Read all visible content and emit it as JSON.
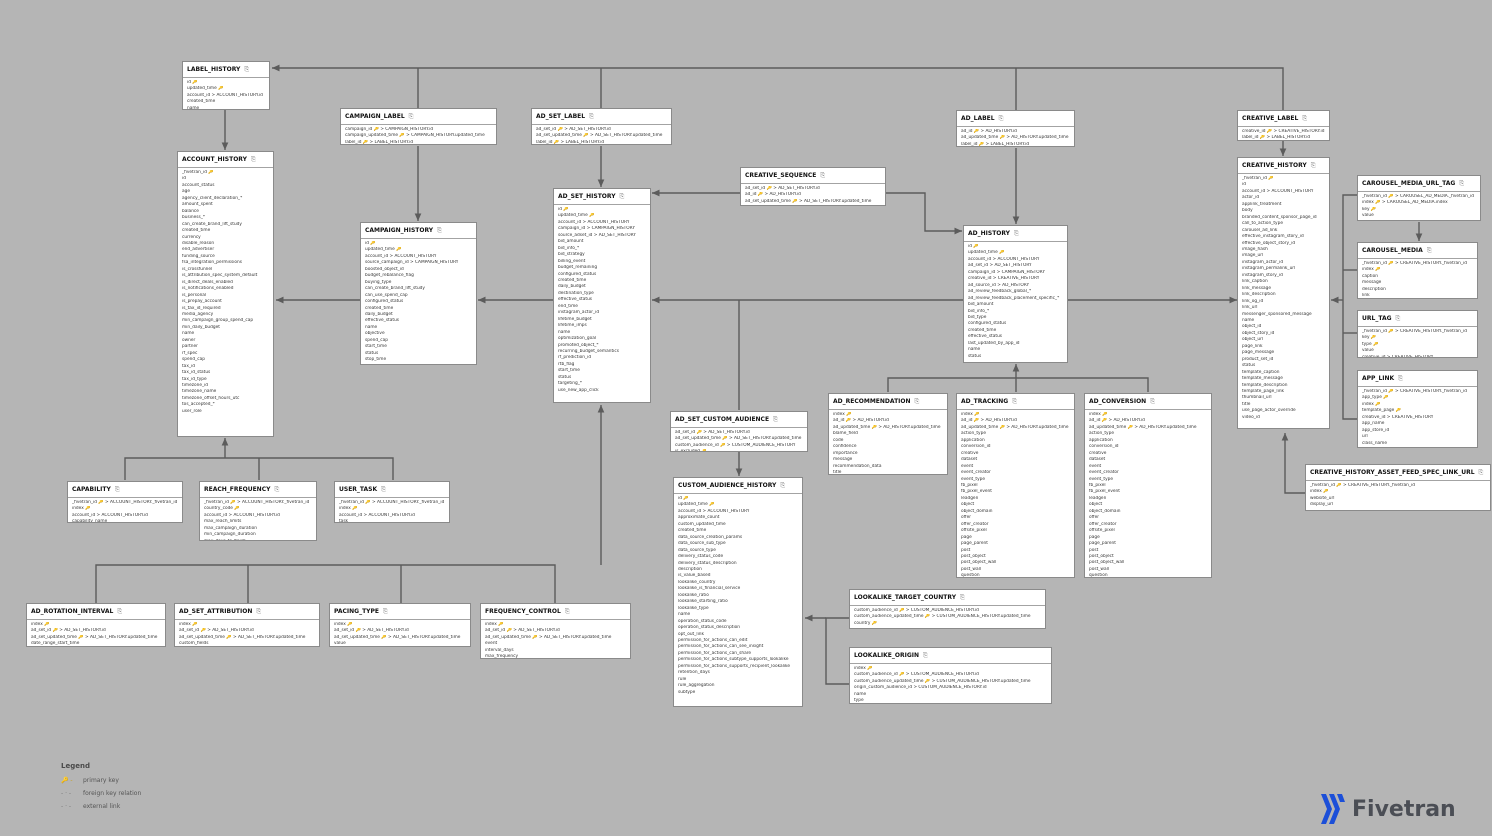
{
  "colors": {
    "background": "#b5b5b5",
    "line": "#5c5c5c",
    "primary_key": "#caa20a",
    "brand": "#1c4fd8"
  },
  "tables": [
    {
      "name": "LABEL_HISTORY",
      "fields": [
        "id 🔑",
        "updated_time 🔑",
        "account_id > ACCOUNT_HISTORY.id",
        "created_time",
        "name"
      ]
    },
    {
      "name": "CAMPAIGN_LABEL",
      "fields": [
        "campaign_id 🔑 > CAMPAIGN_HISTORY.id",
        "campaign_updated_time 🔑 > CAMPAIGN_HISTORY.updated_time",
        "label_id 🔑 > LABEL_HISTORY.id"
      ]
    },
    {
      "name": "AD_SET_LABEL",
      "fields": [
        "ad_set_id 🔑 > AD_SET_HISTORY.id",
        "ad_set_updated_time 🔑 > AD_SET_HISTORY.updated_time",
        "label_id 🔑 > LABEL_HISTORY.id"
      ]
    },
    {
      "name": "AD_LABEL",
      "fields": [
        "ad_id 🔑 > AD_HISTORY.id",
        "ad_updated_time 🔑 > AD_HISTORY.updated_time",
        "label_id 🔑 > LABEL_HISTORY.id"
      ]
    },
    {
      "name": "CREATIVE_LABEL",
      "fields": [
        "creative_id 🔑 > CREATIVE_HISTORY.id",
        "label_id 🔑 > LABEL_HISTORY.id"
      ]
    },
    {
      "name": "ACCOUNT_HISTORY",
      "fields": [
        "_fivetran_id 🔑",
        "id",
        "account_status",
        "age",
        "agency_client_declaration_*",
        "amount_spent",
        "balance",
        "business_*",
        "can_create_brand_lift_study",
        "created_time",
        "currency",
        "disable_reason",
        "end_advertiser",
        "funding_source",
        "fsa_integration_permissions",
        "is_crossfunnel",
        "is_attribution_spec_system_default",
        "is_direct_deals_enabled",
        "is_notifications_enabled",
        "is_personal",
        "is_prepay_account",
        "is_tax_id_required",
        "media_agency",
        "min_campaign_group_spend_cap",
        "min_daily_budget",
        "name",
        "owner",
        "partner",
        "rf_spec",
        "spend_cap",
        "tax_id",
        "tax_id_status",
        "tax_id_type",
        "timezone_id",
        "timezone_name",
        "timezone_offset_hours_utc",
        "tos_accepted_*",
        "user_role"
      ]
    },
    {
      "name": "CAMPAIGN_HISTORY",
      "fields": [
        "id 🔑",
        "updated_time 🔑",
        "account_id > ACCOUNT_HISTORY",
        "source_campaign_id > CAMPAIGN_HISTORY",
        "boosted_object_id",
        "budget_rebalance_flag",
        "buying_type",
        "can_create_brand_lift_study",
        "can_use_spend_cap",
        "configured_status",
        "created_time",
        "daily_budget",
        "effective_status",
        "name",
        "objective",
        "spend_cap",
        "start_time",
        "status",
        "stop_time"
      ]
    },
    {
      "name": "AD_SET_HISTORY",
      "fields": [
        "id 🔑",
        "updated_time 🔑",
        "account_id > ACCOUNT_HISTORY",
        "campaign_id > CAMPAIGN_HISTORY",
        "source_adset_id > AD_SET_HISTORY",
        "bid_amount",
        "bid_info_*",
        "bid_strategy",
        "billing_event",
        "budget_remaining",
        "configured_status",
        "created_time",
        "daily_budget",
        "destination_type",
        "effective_status",
        "end_time",
        "instagram_actor_id",
        "lifetime_budget",
        "lifetime_imps",
        "name",
        "optimization_goal",
        "promoted_object_*",
        "recurring_budget_semantics",
        "rf_prediction_id",
        "rtb_flag",
        "start_time",
        "status",
        "targeting_*",
        "use_new_app_click"
      ]
    },
    {
      "name": "CREATIVE_SEQUENCE",
      "fields": [
        "ad_set_id 🔑 > AD_SET_HISTORY.id",
        "ad_id 🔑 > AD_HISTORY.id",
        "ad_set_updated_time 🔑 > AD_SET_HISTORY.updated_time"
      ]
    },
    {
      "name": "AD_HISTORY",
      "fields": [
        "id 🔑",
        "updated_time 🔑",
        "account_id > ACCOUNT_HISTORY",
        "ad_set_id > AD_SET_HISTORY",
        "campaign_id > CAMPAIGN_HISTORY",
        "creative_id > CREATIVE_HISTORY",
        "ad_source_id > AD_HISTORY",
        "ad_review_feedback_global_*",
        "ad_review_feedback_placement_specific_*",
        "bid_amount",
        "bid_info_*",
        "bid_type",
        "configured_status",
        "created_time",
        "effective_status",
        "last_updated_by_app_id",
        "name",
        "status"
      ]
    },
    {
      "name": "CREATIVE_HISTORY",
      "fields": [
        "_fivetran_id 🔑",
        "id",
        "account_id > ACCOUNT_HISTORY",
        "actor_id",
        "applink_treatment",
        "body",
        "branded_content_sponsor_page_id",
        "call_to_action_type",
        "carousel_ad_link",
        "effective_instagram_story_id",
        "effective_object_story_id",
        "image_hash",
        "image_url",
        "instagram_actor_id",
        "instagram_permalink_url",
        "instagram_story_id",
        "link_caption",
        "link_message",
        "link_description",
        "link_og_id",
        "link_url",
        "messenger_sponsored_message",
        "name",
        "object_id",
        "object_story_id",
        "object_url",
        "page_link",
        "page_message",
        "product_set_id",
        "status",
        "template_caption",
        "template_message",
        "template_description",
        "template_page_link",
        "thumbnail_url",
        "title",
        "use_page_actor_override",
        "video_id"
      ]
    },
    {
      "name": "CAROUSEL_MEDIA_URL_TAG",
      "fields": [
        "_fivetran_id 🔑 > CAROUSEL_AD_MEDIA._fivetran_id",
        "index 🔑 > CAROUSEL_AD_MEDIA.index",
        "key 🔑",
        "value"
      ]
    },
    {
      "name": "CAROUSEL_MEDIA",
      "fields": [
        "_fivetran_id 🔑 > CREATIVE_HISTORY._fivetran_id",
        "index 🔑",
        "caption",
        "message",
        "description",
        "link",
        "creative_id > CREATIVE_HISTORY"
      ]
    },
    {
      "name": "URL_TAG",
      "fields": [
        "_fivetran_id 🔑 > CREATIVE_HISTORY._fivetran_id",
        "key 🔑",
        "type 🔑",
        "value",
        "creative_id > CREATIVE_HISTORY"
      ]
    },
    {
      "name": "APP_LINK",
      "fields": [
        "_fivetran_id 🔑 > CREATIVE_HISTORY._fivetran_id",
        "app_type 🔑",
        "index 🔑",
        "template_page 🔑",
        "creative_id > CREATIVE_HISTORY",
        "app_name",
        "app_store_id",
        "url",
        "class_name",
        "package_name"
      ]
    },
    {
      "name": "CREATIVE_HISTORY_ASSET_FEED_SPEC_LINK_URL",
      "fields": [
        "_fivetran_id 🔑 > CREATIVE_HISTORY._fivetran_id",
        "index 🔑",
        "website_url",
        "display_url"
      ]
    },
    {
      "name": "CAPABILITY",
      "fields": [
        "_fivetran_id 🔑 > ACCOUNT_HISTORY._fivetran_id",
        "index 🔑",
        "account_id > ACCOUNT_HISTORY.id",
        "capability_name"
      ]
    },
    {
      "name": "REACH_FREQUENCY",
      "fields": [
        "_fivetran_id 🔑 > ACCOUNT_HISTORY._fivetran_id",
        "country_code 🔑",
        "account_id > ACCOUNT_HISTORY.id",
        "max_reach_limits",
        "max_campaign_duration",
        "min_campaign_duration",
        "max_days_to_finish"
      ]
    },
    {
      "name": "USER_TASK",
      "fields": [
        "_fivetran_id 🔑 > ACCOUNT_HISTORY._fivetran_id",
        "index 🔑",
        "account_id > ACCOUNT_HISTORY.id",
        "task"
      ]
    },
    {
      "name": "AD_SET_CUSTOM_AUDIENCE",
      "fields": [
        "ad_set_id 🔑 > AD_SET_HISTORY.id",
        "ad_set_updated_time 🔑 > AD_SET_HISTORY.updated_time",
        "custom_audience_id 🔑 > CUSTOM_AUDIENCE_HISTORY",
        "is_excluded 🔑"
      ]
    },
    {
      "name": "CUSTOM_AUDIENCE_HISTORY",
      "fields": [
        "id 🔑",
        "updated_time 🔑",
        "account_id > ACCOUNT_HISTORY",
        "approximate_count",
        "custom_updated_time",
        "created_time",
        "data_source_creation_params",
        "data_source_sub_type",
        "data_source_type",
        "delivery_status_code",
        "delivery_status_description",
        "description",
        "is_value_based",
        "lookalike_country",
        "lookalike_is_financial_service",
        "lookalike_ratio",
        "lookalike_starting_ratio",
        "lookalike_type",
        "name",
        "operation_status_code",
        "operation_status_description",
        "opt_out_link",
        "permission_for_actions_can_edit",
        "permission_for_actions_can_see_insight",
        "permission_for_actions_can_share",
        "permission_for_actions_subtype_supports_lookalike",
        "permission_for_actions_supports_recipient_lookalike",
        "retention_days",
        "rule",
        "rule_aggregation",
        "subtype"
      ]
    },
    {
      "name": "AD_RECOMMENDATION",
      "fields": [
        "index 🔑",
        "ad_id 🔑 > AD_HISTORY.id",
        "ad_updated_time 🔑 > AD_HISTORY.updated_time",
        "blame_field",
        "code",
        "confidence",
        "importance",
        "message",
        "recommendation_data",
        "title"
      ]
    },
    {
      "name": "AD_TRACKING",
      "fields": [
        "index 🔑",
        "ad_id 🔑 > AD_HISTORY.id",
        "ad_updated_time 🔑 > AD_HISTORY.updated_time",
        "action_type",
        "application",
        "conversion_id",
        "creative",
        "dataset",
        "event",
        "event_creator",
        "event_type",
        "fb_pixel",
        "fb_pixel_event",
        "leadgen",
        "object",
        "object_domain",
        "offer",
        "offer_creator",
        "offsite_pixel",
        "page",
        "page_parent",
        "post",
        "post_object",
        "post_object_wall",
        "post_wall",
        "question",
        "question_creator",
        "response",
        "subtype"
      ]
    },
    {
      "name": "AD_CONVERSION",
      "fields": [
        "index 🔑",
        "ad_id 🔑 > AD_HISTORY.id",
        "ad_updated_time 🔑 > AD_HISTORY.updated_time",
        "action_type",
        "application",
        "conversion_id",
        "creative",
        "dataset",
        "event",
        "event_creator",
        "event_type",
        "fb_pixel",
        "fb_pixel_event",
        "leadgen",
        "object",
        "object_domain",
        "offer",
        "offer_creator",
        "offsite_pixel",
        "page",
        "page_parent",
        "post",
        "post_object",
        "post_object_wall",
        "post_wall",
        "question",
        "question_creator",
        "response",
        "subtype"
      ]
    },
    {
      "name": "AD_ROTATION_INTERVAL",
      "fields": [
        "index 🔑",
        "ad_set_id 🔑 > AD_SET_HISTORY.id",
        "ad_set_updated_time 🔑 > AD_SET_HISTORY.updated_time",
        "date_range_start_time"
      ]
    },
    {
      "name": "AD_SET_ATTRIBUTION",
      "fields": [
        "index 🔑",
        "ad_set_id 🔑 > AD_SET_HISTORY.id",
        "ad_set_updated_time 🔑 > AD_SET_HISTORY.updated_time",
        "custom_fields"
      ]
    },
    {
      "name": "PACING_TYPE",
      "fields": [
        "index 🔑",
        "ad_set_id 🔑 > AD_SET_HISTORY.id",
        "ad_set_updated_time 🔑 > AD_SET_HISTORY.updated_time",
        "value"
      ]
    },
    {
      "name": "FREQUENCY_CONTROL",
      "fields": [
        "index 🔑",
        "ad_set_id 🔑 > AD_SET_HISTORY.id",
        "ad_set_updated_time 🔑 > AD_SET_HISTORY.updated_time",
        "event",
        "interval_days",
        "max_frequency"
      ]
    },
    {
      "name": "LOOKALIKE_TARGET_COUNTRY",
      "fields": [
        "custom_audience_id 🔑 > CUSTOM_AUDIENCE_HISTORY.id",
        "custom_audience_updated_time 🔑 > CUSTOM_AUDIENCE_HISTORY.updated_time",
        "country 🔑"
      ]
    },
    {
      "name": "LOOKALIKE_ORIGIN",
      "fields": [
        "index 🔑",
        "custom_audience_id 🔑 > CUSTOM_AUDIENCE_HISTORY.id",
        "custom_audience_updated_time 🔑 > CUSTOM_AUDIENCE_HISTORY.updated_time",
        "origin_custom_audience_id > CUSTOM_AUDIENCE_HISTORY.id",
        "name",
        "type"
      ]
    }
  ],
  "legend": {
    "title": "Legend",
    "items": [
      {
        "symbol": "🔑 -",
        "label": "primary key"
      },
      {
        "symbol": "- · -",
        "label": "foreign key relation"
      },
      {
        "symbol": "- · -",
        "label": "external link"
      }
    ]
  },
  "brand": {
    "name": "Fivetran"
  }
}
